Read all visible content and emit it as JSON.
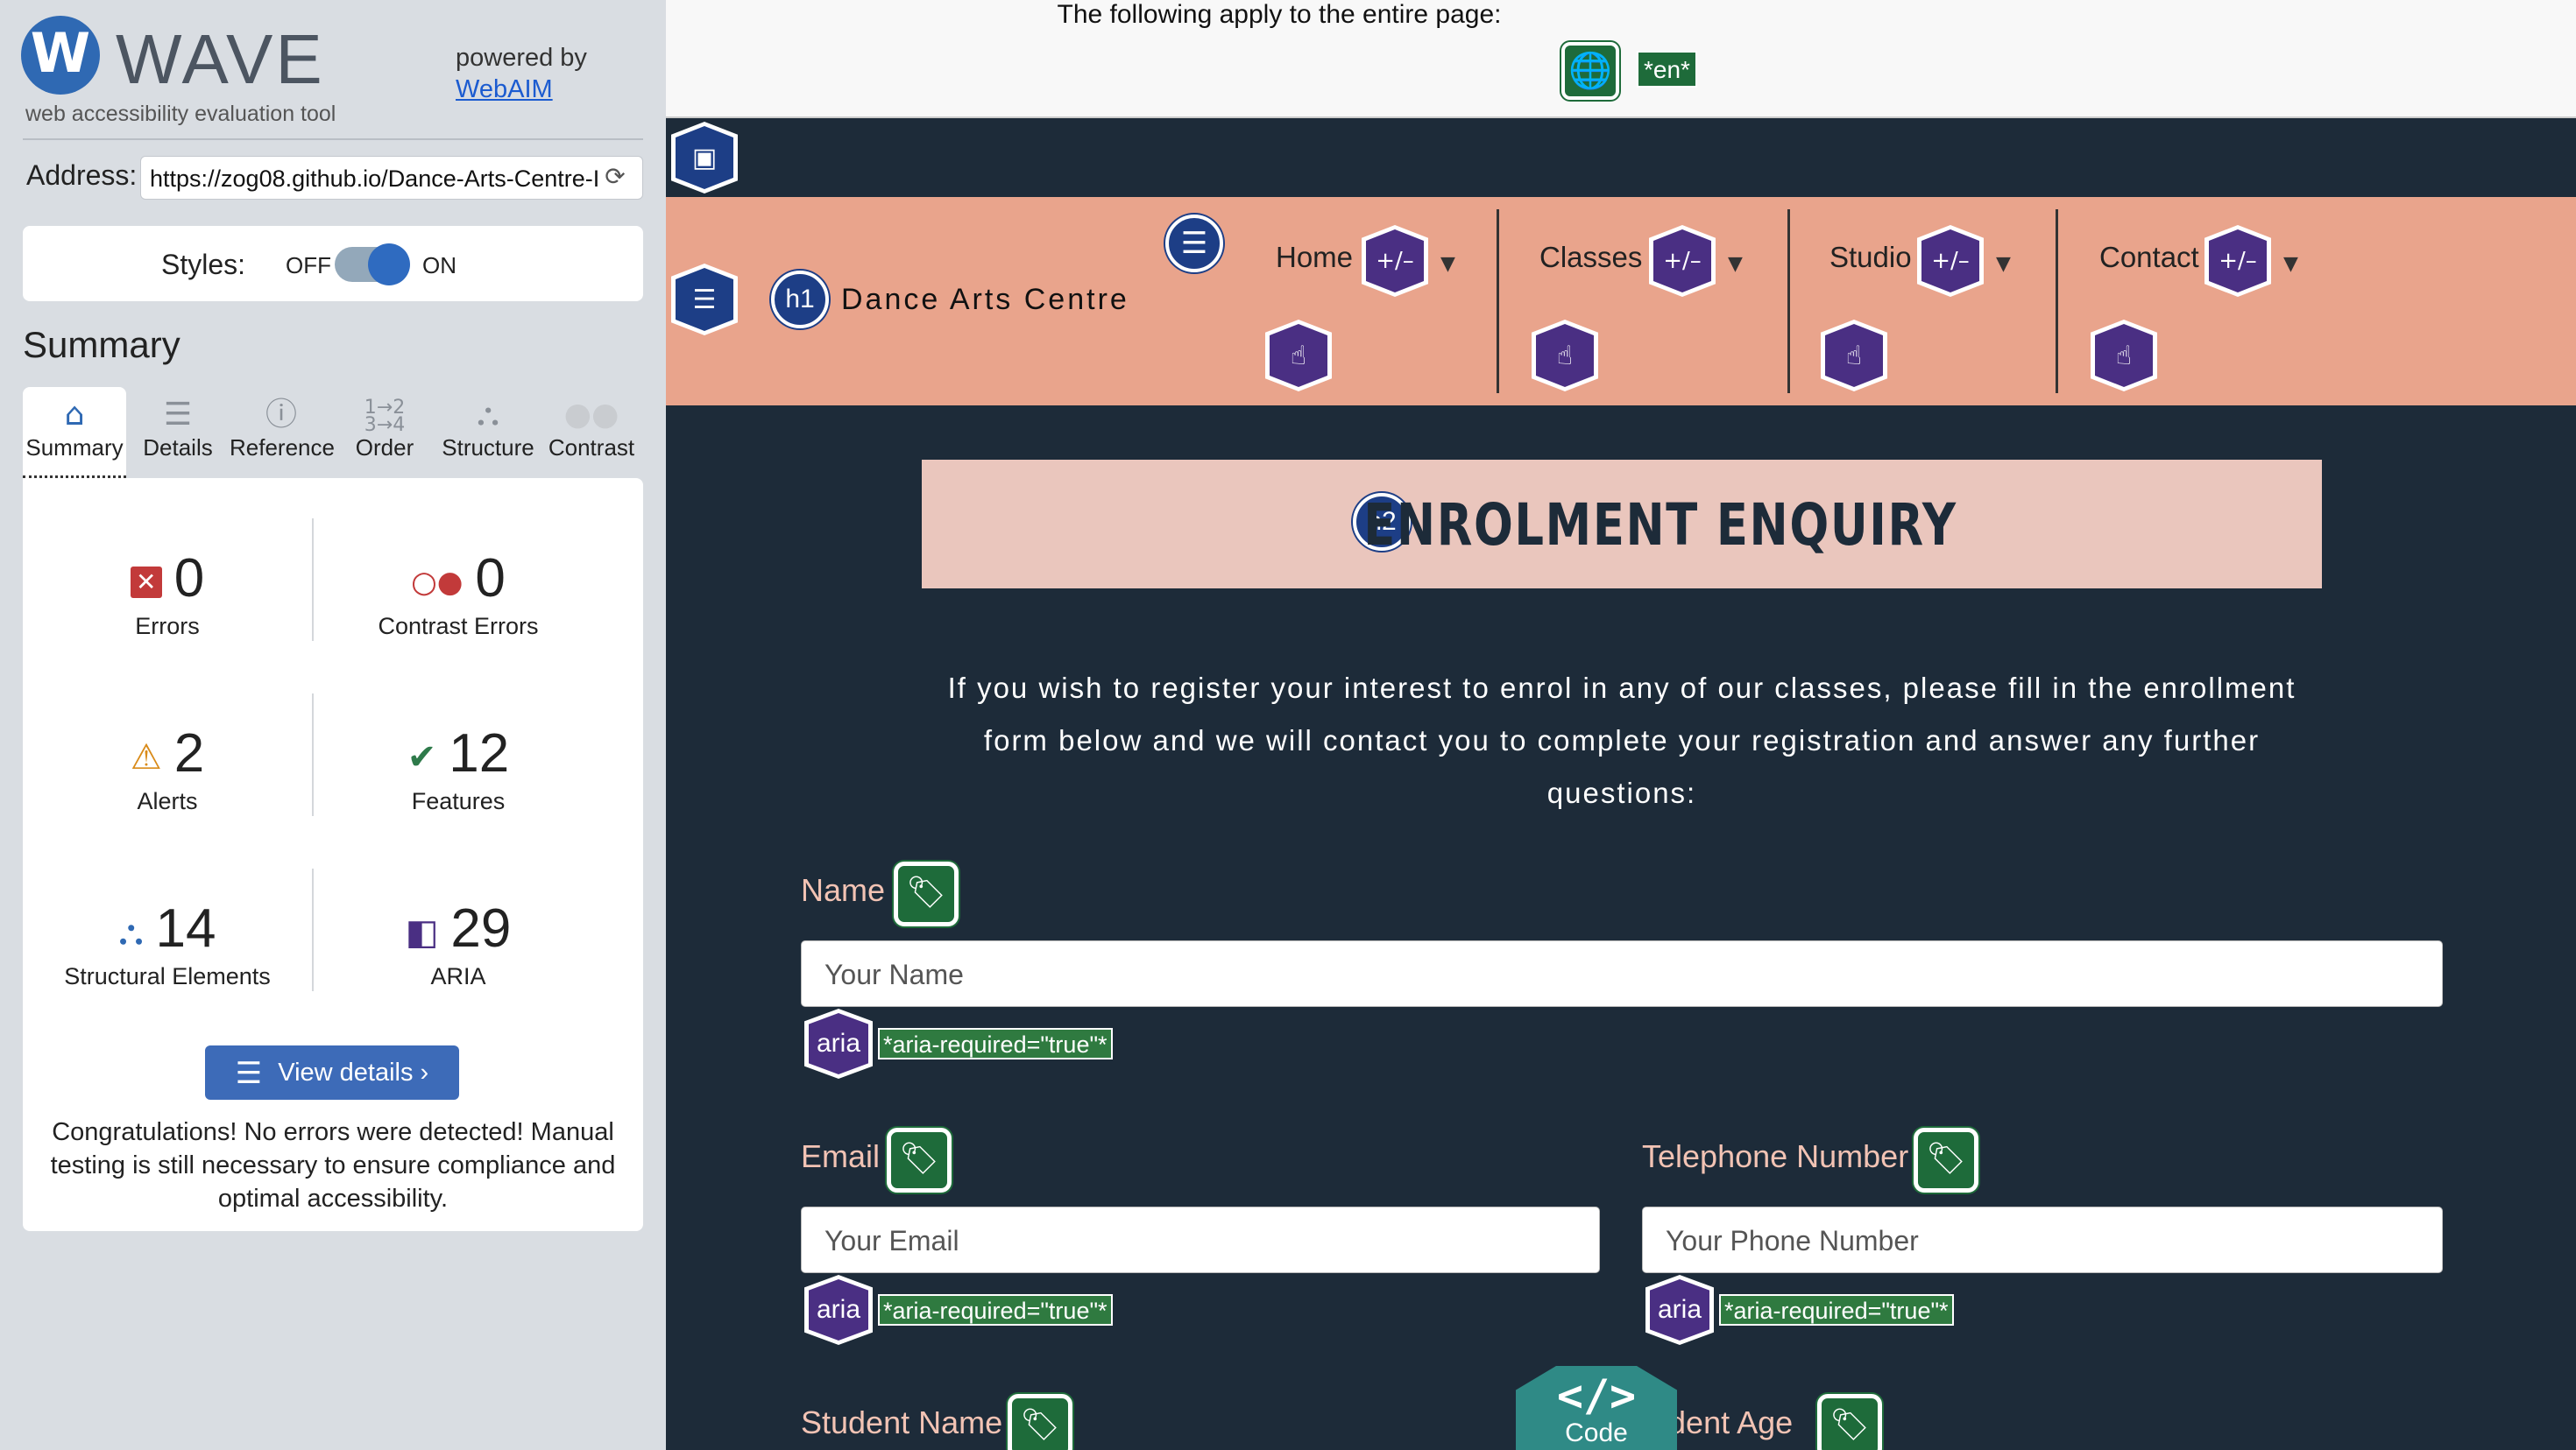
{
  "panel": {
    "logo_letter": "W",
    "logo_word": "WAVE",
    "tagline": "web accessibility evaluation tool",
    "powered_by": "powered by",
    "webaim_link": "WebAIM",
    "address_label": "Address:",
    "address_value": "https://zog08.github.io/Dance-Arts-Centre-I",
    "styles_label": "Styles:",
    "styles_off": "OFF",
    "styles_on": "ON",
    "summary_heading": "Summary",
    "tabs": [
      {
        "label": "Summary",
        "icon": "home-icon"
      },
      {
        "label": "Details",
        "icon": "list-icon"
      },
      {
        "label": "Reference",
        "icon": "info-icon"
      },
      {
        "label": "Order",
        "icon": "order-icon"
      },
      {
        "label": "Structure",
        "icon": "structure-icon"
      },
      {
        "label": "Contrast",
        "icon": "contrast-icon"
      }
    ],
    "stats": {
      "errors": {
        "count": "0",
        "label": "Errors"
      },
      "contrast_errors": {
        "count": "0",
        "label": "Contrast Errors"
      },
      "alerts": {
        "count": "2",
        "label": "Alerts"
      },
      "features": {
        "count": "12",
        "label": "Features"
      },
      "structural": {
        "count": "14",
        "label": "Structural Elements"
      },
      "aria": {
        "count": "29",
        "label": "ARIA"
      }
    },
    "view_details": "View details ›",
    "congrats": "Congratulations! No errors were detected! Manual testing is still necessary to ensure compliance and optimal accessibility."
  },
  "page": {
    "applies_text": "The following apply to the entire page:",
    "lang_badge": "*en*",
    "site_title": "Dance Arts Centre",
    "h1_badge": "h1",
    "h2_badge": "h2",
    "nav": [
      {
        "label": "Home"
      },
      {
        "label": "Classes"
      },
      {
        "label": "Studio"
      },
      {
        "label": "Contact"
      }
    ],
    "expand_label": "+/–",
    "heading": "ENROLMENT ENQUIRY",
    "intro": "If you wish to register your interest to enrol in any of our classes, please fill in the enrollment form below and we will contact you to complete your registration and answer any further questions:",
    "form": {
      "name_label": "Name",
      "name_placeholder": "Your Name",
      "email_label": "Email",
      "email_placeholder": "Your Email",
      "phone_label": "Telephone Number",
      "phone_placeholder": "Your Phone Number",
      "student_name_label": "Student Name",
      "student_age_label": "udent Age"
    },
    "aria_text": "aria",
    "aria_required": "*aria-required=\"true\"*",
    "code_glyph": "</>",
    "code_label": "Code"
  },
  "colors": {
    "wave_blue": "#2f69b3",
    "nav_salmon": "#e9a48c",
    "heading_pink": "#eac6bd",
    "page_dark": "#1d2b39",
    "aria_purple": "#4a2f83",
    "feature_green": "#1e6b3a",
    "error_red": "#c23a3a",
    "alert_orange": "#d98b1a"
  }
}
